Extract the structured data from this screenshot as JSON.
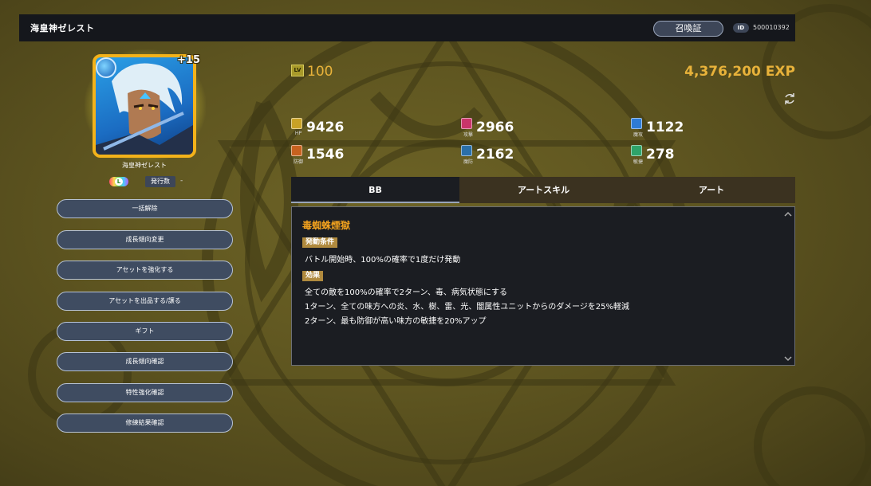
{
  "header": {
    "title": "海皇神ゼレスト",
    "summon_button": "召喚証",
    "id_label": "ID",
    "id_value": "500010392"
  },
  "unit": {
    "plus_level": "+15",
    "name": "海皇神ゼレスト",
    "rarity_letter": "L",
    "issue_label": "発行数",
    "issue_value": "-",
    "element": "water-icon"
  },
  "side_buttons": [
    "一括解除",
    "成長傾向変更",
    "アセットを強化する",
    "アセットを出品する/譲る",
    "ギフト",
    "成長傾向確認",
    "特性強化確認",
    "修練結果確認"
  ],
  "level": {
    "icon_label": "LV",
    "value": "100"
  },
  "exp": "4,376,200 EXP",
  "stats": [
    {
      "label": "HP",
      "value": "9426",
      "icon": "hp-icon",
      "color": "#c9a227"
    },
    {
      "label": "攻撃",
      "value": "2966",
      "icon": "attack-icon",
      "color": "#c9356a"
    },
    {
      "label": "魔攻",
      "value": "1122",
      "icon": "magic-attack-icon",
      "color": "#2e7bd6"
    },
    {
      "label": "防御",
      "value": "1546",
      "icon": "defense-icon",
      "color": "#c8621f"
    },
    {
      "label": "魔防",
      "value": "2162",
      "icon": "magic-defense-icon",
      "color": "#2a6fa8"
    },
    {
      "label": "敏捷",
      "value": "278",
      "icon": "agility-icon",
      "color": "#2fa36a"
    }
  ],
  "tabs": [
    "BB",
    "アートスキル",
    "アート"
  ],
  "active_tab": 0,
  "skill": {
    "name": "毒蜘蛛煙獄",
    "trigger_label": "発動条件",
    "trigger_text": "バトル開始時、100%の確率で1度だけ発動",
    "effect_label": "効果",
    "effects": [
      "全ての敵を100%の確率で2ターン、毒、病気状態にする",
      "1ターン、全ての味方への炎、水、樹、雷、光、闇属性ユニットからのダメージを25%軽減",
      "2ターン、最も防御が高い味方の敏捷を20%アップ"
    ]
  }
}
